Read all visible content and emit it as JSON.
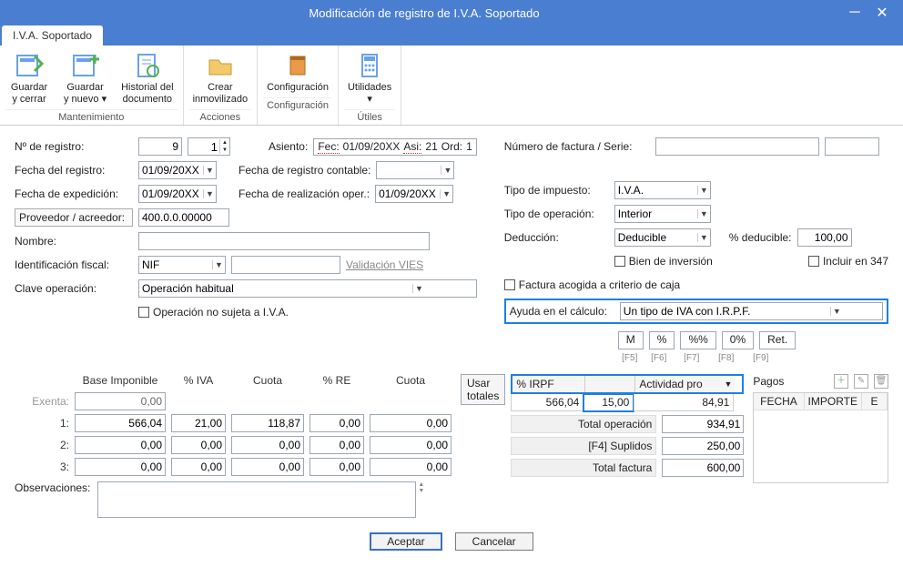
{
  "window": {
    "title": "Modificación de registro de I.V.A. Soportado"
  },
  "tab": {
    "label": "I.V.A. Soportado"
  },
  "ribbon": {
    "groups": [
      {
        "label": "Mantenimiento",
        "buttons": [
          {
            "id": "guardar-cerrar",
            "line1": "Guardar",
            "line2": "y cerrar"
          },
          {
            "id": "guardar-nuevo",
            "line1": "Guardar",
            "line2": "y nuevo ▾"
          },
          {
            "id": "historial",
            "line1": "Historial del",
            "line2": "documento"
          }
        ]
      },
      {
        "label": "Acciones",
        "buttons": [
          {
            "id": "crear-inmov",
            "line1": "Crear",
            "line2": "inmovilizado"
          }
        ]
      },
      {
        "label": "Configuración",
        "buttons": [
          {
            "id": "config",
            "line1": "Configuración",
            "line2": ""
          }
        ]
      },
      {
        "label": "Útiles",
        "buttons": [
          {
            "id": "utilidades",
            "line1": "Utilidades",
            "line2": "▾"
          }
        ]
      }
    ]
  },
  "left": {
    "nregistro_lbl": "Nº de registro:",
    "nregistro": "9",
    "nregistro2": "1",
    "fecha_registro_lbl": "Fecha del registro:",
    "fecha_registro": "01/09/20XX",
    "fecha_exped_lbl": "Fecha de expedición:",
    "fecha_exped": "01/09/20XX",
    "proveedor_lbl": "Proveedor / acreedor:",
    "proveedor": "400.0.0.00000",
    "nombre_lbl": "Nombre:",
    "nombre": "",
    "idfiscal_lbl": "Identificación fiscal:",
    "idfiscal_tipo": "NIF",
    "idfiscal_num": "",
    "validacion_vies": "Validación VIES",
    "claveop_lbl": "Clave operación:",
    "claveop": "Operación habitual",
    "no_sujeta_lbl": "Operación no sujeta a I.V.A.",
    "asiento_lbl": "Asiento:",
    "asiento_fec_lbl": "Fec:",
    "asiento_fec": "01/09/20XX",
    "asiento_asi_lbl": "Asi:",
    "asiento_asi": "21",
    "asiento_ord_lbl": "Ord:",
    "asiento_ord": "1",
    "fecha_reg_cont_lbl": "Fecha de registro contable:",
    "fecha_reg_cont": "",
    "fecha_real_oper_lbl": "Fecha de realización oper.:",
    "fecha_real_oper": "01/09/20XX"
  },
  "right": {
    "numfact_lbl": "Número de factura / Serie:",
    "numfact": "",
    "serie": "",
    "tipoimp_lbl": "Tipo de impuesto:",
    "tipoimp": "I.V.A.",
    "tipoop_lbl": "Tipo de operación:",
    "tipoop": "Interior",
    "deduccion_lbl": "Deducción:",
    "deduccion": "Deducible",
    "pct_ded_lbl": "% deducible:",
    "pct_ded": "100,00",
    "bien_inv_lbl": "Bien de inversión",
    "incluir347_lbl": "Incluir en 347",
    "factura_caja_lbl": "Factura acogida a criterio de caja",
    "ayuda_calc_lbl": "Ayuda en el cálculo:",
    "ayuda_calc": "Un tipo de IVA con I.R.P.F.",
    "calc": {
      "b1": "M",
      "b2": "%",
      "b3": "%%",
      "b4": "0%",
      "b5": "Ret.",
      "h1": "[F5]",
      "h2": "[F6]",
      "h3": "[F7]",
      "h4": "[F8]",
      "h5": "[F9]"
    }
  },
  "lines": {
    "headers": {
      "base": "Base Imponible",
      "pctiva": "% IVA",
      "cuota": "Cuota",
      "pctre": "% RE",
      "cuota2": "Cuota"
    },
    "usar_totales": "Usar totales",
    "exenta_lbl": "Exenta:",
    "exenta": "0,00",
    "r1_lbl": "1:",
    "r1": {
      "base": "566,04",
      "pctiva": "21,00",
      "cuota": "118,87",
      "pctre": "0,00",
      "cuota2": "0,00"
    },
    "r2_lbl": "2:",
    "r2": {
      "base": "0,00",
      "pctiva": "0,00",
      "cuota": "0,00",
      "pctre": "0,00",
      "cuota2": "0,00"
    },
    "r3_lbl": "3:",
    "r3": {
      "base": "0,00",
      "pctiva": "0,00",
      "cuota": "0,00",
      "pctre": "0,00",
      "cuota2": "0,00"
    },
    "obs_lbl": "Observaciones:",
    "obs": ""
  },
  "totals": {
    "pct_irpf_lbl": "% IRPF",
    "actividad_lbl": "Actividad pro",
    "irpf_base": "566,04",
    "irpf_pct": "15,00",
    "irpf_imp": "84,91",
    "tot_op_lbl": "Total operación",
    "tot_op": "934,91",
    "supl_lbl": "[F4] Suplidos",
    "supl": "250,00",
    "tot_fact_lbl": "Total factura",
    "tot_fact": "600,00"
  },
  "pagos": {
    "title": "Pagos",
    "col1": "FECHA",
    "col2": "IMPORTE",
    "col3": "E"
  },
  "footer": {
    "aceptar": "Aceptar",
    "cancelar": "Cancelar"
  }
}
